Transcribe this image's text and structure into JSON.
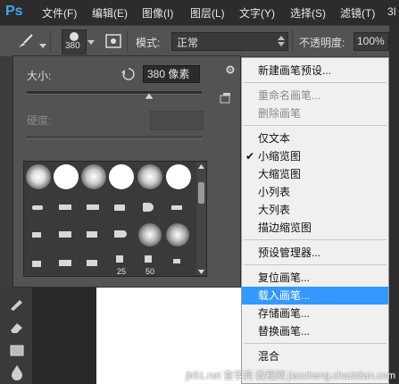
{
  "menubar": {
    "logo": "Ps",
    "items": [
      "文件(F)",
      "编辑(E)",
      "图像(I)",
      "图层(L)",
      "文字(Y)",
      "选择(S)",
      "滤镜(T)",
      "3I"
    ]
  },
  "options_bar": {
    "brush_size": "380",
    "mode_label": "模式:",
    "mode_value": "正常",
    "opacity_label": "不透明度:",
    "opacity_value": "100%"
  },
  "brush_panel": {
    "size_label": "大小:",
    "size_value": "380 像素",
    "hardness_label": "硬度:",
    "size_slider_fraction": 0.7,
    "thumb_labels": [
      "25",
      "50"
    ]
  },
  "context_menu": {
    "items": [
      {
        "label": "新建画笔预设...",
        "enabled": true
      },
      {
        "sep": true
      },
      {
        "label": "重命名画笔...",
        "enabled": false
      },
      {
        "label": "删除画笔",
        "enabled": false
      },
      {
        "sep": true
      },
      {
        "label": "仅文本",
        "enabled": true
      },
      {
        "label": "小缩览图",
        "enabled": true,
        "checked": true
      },
      {
        "label": "大缩览图",
        "enabled": true
      },
      {
        "label": "小列表",
        "enabled": true
      },
      {
        "label": "大列表",
        "enabled": true
      },
      {
        "label": "描边缩览图",
        "enabled": true
      },
      {
        "sep": true
      },
      {
        "label": "预设管理器...",
        "enabled": true
      },
      {
        "sep": true
      },
      {
        "label": "复位画笔...",
        "enabled": true
      },
      {
        "label": "载入画笔...",
        "enabled": true,
        "highlighted": true
      },
      {
        "label": "存储画笔...",
        "enabled": true
      },
      {
        "label": "替换画笔...",
        "enabled": true
      },
      {
        "sep": true
      },
      {
        "label": "混合",
        "enabled": true
      }
    ]
  },
  "watermark": "jb51.net 查字典 教程网 jiaocheng.chazidian.com",
  "colors": {
    "highlight": "#3399ff",
    "panel": "#535353",
    "menubar": "#2c2c2c"
  }
}
